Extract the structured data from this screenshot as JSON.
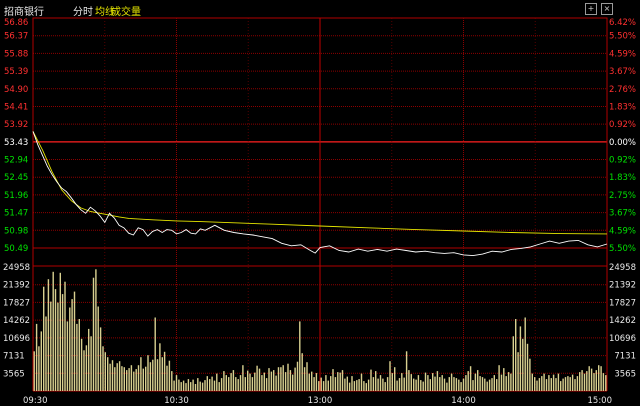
{
  "header": {
    "stock_name": "招商银行",
    "view_mode": "分时",
    "avg_line_label": "均线",
    "volume_label": "成交量",
    "plus_icon": "plus-icon",
    "close_icon": "close-icon"
  },
  "chart_data": {
    "type": "line",
    "title": "",
    "x_ticks": [
      "09:30",
      "10:30",
      "13:00",
      "14:00",
      "15:00"
    ],
    "price_axis_left": [
      "56.86",
      "56.37",
      "55.88",
      "55.39",
      "54.90",
      "54.41",
      "53.92",
      "53.43",
      "52.94",
      "52.45",
      "51.96",
      "51.47",
      "50.98",
      "50.49"
    ],
    "percent_axis_right": [
      "6.42%",
      "5.50%",
      "4.59%",
      "3.67%",
      "2.76%",
      "1.83%",
      "0.92%",
      "0.00%",
      "0.92%",
      "1.83%",
      "2.75%",
      "3.67%",
      "4.59%",
      "5.50%"
    ],
    "volume_axis": [
      "24958",
      "21392",
      "17827",
      "14262",
      "10696",
      "7131",
      "3565"
    ],
    "volume_axis_right": [
      "24958",
      "21392",
      "17827",
      "14262",
      "10696",
      "7131",
      "3565"
    ],
    "ylim": [
      50.49,
      56.86
    ],
    "reference_price": 53.43,
    "colors": {
      "up": "#ff3030",
      "down": "#00e000",
      "flat": "#ffffff",
      "price_line": "#ffffff",
      "avg_line": "#e6e600",
      "volume": "#d8d090",
      "grid": "#8b0000"
    },
    "series": [
      {
        "name": "分时",
        "x": [
          0,
          2,
          4,
          6,
          8,
          10,
          12,
          14,
          16,
          18,
          20,
          22,
          24,
          26,
          28,
          30,
          32,
          34,
          36,
          38,
          40,
          42,
          44,
          46,
          48,
          50,
          52,
          54,
          56,
          58,
          60,
          62,
          64,
          66,
          68,
          70,
          72,
          74,
          76,
          78,
          80,
          84,
          88,
          92,
          96,
          100,
          104,
          108,
          112,
          116,
          118,
          120,
          124,
          128,
          132,
          136,
          140,
          144,
          148,
          152,
          156,
          160,
          164,
          168,
          172,
          176,
          180,
          184,
          188,
          192,
          196,
          200,
          204,
          208,
          212,
          216,
          220,
          224,
          228,
          232,
          236,
          240
        ],
        "values": [
          53.72,
          53.35,
          53.05,
          52.75,
          52.52,
          52.32,
          52.15,
          52.05,
          51.88,
          51.7,
          51.55,
          51.45,
          51.62,
          51.52,
          51.38,
          51.2,
          51.45,
          51.32,
          51.12,
          51.05,
          50.9,
          50.85,
          51.05,
          51.0,
          50.82,
          50.95,
          51.0,
          50.92,
          51.0,
          50.98,
          50.88,
          50.92,
          51.0,
          50.9,
          50.88,
          51.02,
          50.98,
          51.05,
          51.12,
          51.05,
          50.98,
          50.92,
          50.88,
          50.85,
          50.8,
          50.75,
          50.62,
          50.55,
          50.58,
          50.42,
          50.35,
          50.5,
          50.55,
          50.42,
          50.38,
          50.46,
          50.4,
          50.45,
          50.4,
          50.46,
          50.42,
          50.38,
          50.4,
          50.36,
          50.34,
          50.36,
          50.3,
          50.28,
          50.32,
          50.4,
          50.38,
          50.45,
          50.48,
          50.52,
          50.6,
          50.68,
          50.62,
          50.68,
          50.7,
          50.58,
          50.52,
          50.6
        ]
      },
      {
        "name": "均线",
        "x": [
          0,
          4,
          8,
          12,
          16,
          20,
          24,
          28,
          32,
          36,
          40,
          50,
          60,
          70,
          80,
          100,
          120,
          140,
          160,
          180,
          200,
          220,
          240
        ],
        "values": [
          53.72,
          53.2,
          52.6,
          52.1,
          51.8,
          51.6,
          51.5,
          51.45,
          51.4,
          51.35,
          51.31,
          51.27,
          51.24,
          51.22,
          51.2,
          51.15,
          51.1,
          51.05,
          51.0,
          50.96,
          50.92,
          50.89,
          50.88
        ]
      }
    ],
    "volume": [
      8000,
      13500,
      9000,
      12000,
      21000,
      15000,
      22500,
      18000,
      24000,
      20500,
      17800,
      23800,
      19500,
      22000,
      14000,
      16800,
      18500,
      20000,
      13500,
      14500,
      10500,
      8200,
      9200,
      12500,
      11000,
      22800,
      24500,
      17000,
      12800,
      9000,
      7800,
      6800,
      5500,
      6200,
      4800,
      5600,
      6000,
      5000,
      4800,
      4200,
      4600,
      5200,
      3900,
      4400,
      5200,
      6800,
      4500,
      4900,
      7200,
      5800,
      6300,
      14800,
      6400,
      9600,
      6800,
      7900,
      5100,
      6100,
      4000,
      2100,
      3200,
      2300,
      1800,
      2100,
      1600,
      2400,
      1800,
      2300,
      1400,
      2600,
      1900,
      1700,
      2200,
      3000,
      2400,
      2900,
      2100,
      3500,
      1800,
      2600,
      4000,
      3200,
      2800,
      3600,
      4200,
      2800,
      2400,
      3200,
      5200,
      2800,
      4100,
      3500,
      2800,
      3700,
      5100,
      4500,
      3200,
      3700,
      2600,
      4600,
      3900,
      4200,
      3100,
      4800,
      4800,
      5200,
      3800,
      5500,
      4200,
      3300,
      4700,
      5900,
      14000,
      7600,
      4800,
      5800,
      3500,
      3900,
      2800,
      3600,
      2000,
      2700,
      2000,
      3200,
      2100,
      3000,
      4400,
      2800,
      3800,
      3700,
      4200,
      2500,
      2900,
      1700,
      3000,
      2000,
      2200,
      2400,
      3500,
      2000,
      1600,
      2300,
      4300,
      2800,
      4000,
      2500,
      3200,
      2500,
      1800,
      2800,
      6000,
      3600,
      4800,
      2100,
      2600,
      3600,
      2700,
      8000,
      4200,
      3400,
      2500,
      2300,
      3200,
      2200,
      1900,
      3700,
      3200,
      2400,
      3600,
      2900,
      4000,
      2800,
      3200,
      2500,
      1700,
      2800,
      3500,
      2800,
      2600,
      2300,
      1800,
      2500,
      3200,
      4000,
      5000,
      2200,
      3500,
      4200,
      3000,
      2800,
      2500,
      1900,
      2300,
      2600,
      3200,
      2400,
      5200,
      3300,
      4600,
      3000,
      3800,
      3500,
      11000,
      14500,
      7800,
      13000,
      10500,
      14800,
      9500,
      6500,
      3500,
      2800,
      2100,
      2600,
      3000,
      3500,
      2400,
      3200,
      2600,
      3300,
      2600,
      3500,
      2000,
      2500,
      2800,
      3000,
      2800,
      3300,
      2400,
      3000,
      3800,
      4200,
      3500,
      4000,
      5000,
      4500,
      3600,
      4200,
      5200,
      5000,
      3600,
      3200
    ]
  }
}
